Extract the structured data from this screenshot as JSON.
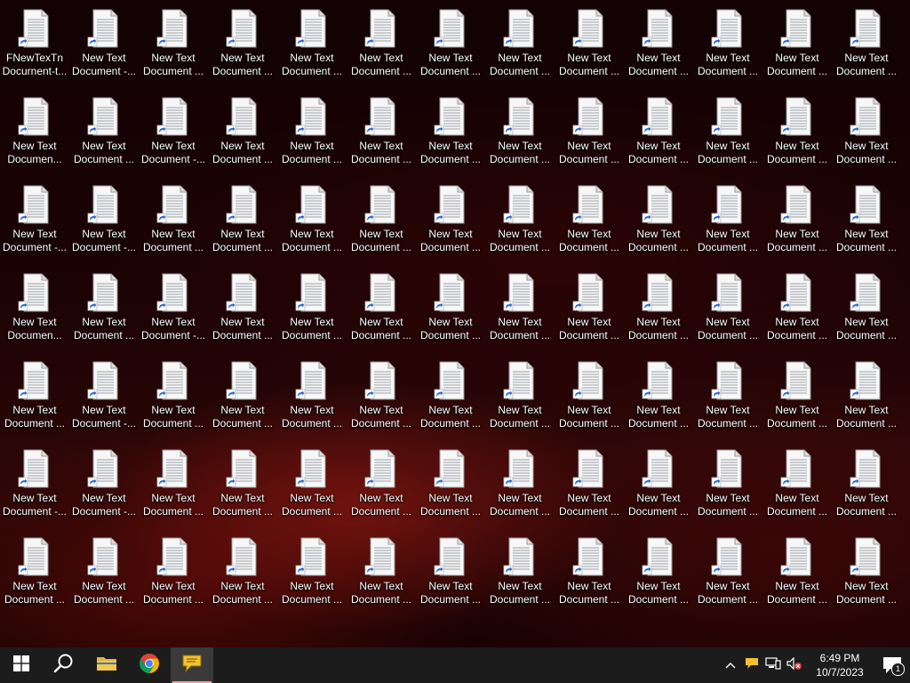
{
  "desktop": {
    "icon_rows": [
      [
        {
          "line1": "FNewTexTn",
          "line2": "Docurnent-t..."
        },
        {
          "line1": "New Text",
          "line2": "Document -..."
        },
        {
          "line1": "New Text",
          "line2": "Document ..."
        },
        {
          "line1": "New Text",
          "line2": "Document ..."
        },
        {
          "line1": "New Text",
          "line2": "Document ..."
        },
        {
          "line1": "New Text",
          "line2": "Document ..."
        },
        {
          "line1": "New Text",
          "line2": "Document ..."
        },
        {
          "line1": "New Text",
          "line2": "Document ..."
        },
        {
          "line1": "New Text",
          "line2": "Document ..."
        },
        {
          "line1": "New Text",
          "line2": "Document ..."
        },
        {
          "line1": "New Text",
          "line2": "Document ..."
        },
        {
          "line1": "New Text",
          "line2": "Document ..."
        },
        {
          "line1": "New Text",
          "line2": "Document ..."
        }
      ],
      [
        {
          "line1": "New Text",
          "line2": "Documen..."
        },
        {
          "line1": "New Text",
          "line2": "Document ..."
        },
        {
          "line1": "New Text",
          "line2": "Document -..."
        },
        {
          "line1": "New Text",
          "line2": "Document ..."
        },
        {
          "line1": "New Text",
          "line2": "Document ..."
        },
        {
          "line1": "New Text",
          "line2": "Document ..."
        },
        {
          "line1": "New Text",
          "line2": "Document ..."
        },
        {
          "line1": "New Text",
          "line2": "Document ..."
        },
        {
          "line1": "New Text",
          "line2": "Document ..."
        },
        {
          "line1": "New Text",
          "line2": "Document ..."
        },
        {
          "line1": "New Text",
          "line2": "Document ..."
        },
        {
          "line1": "New Text",
          "line2": "Document ..."
        },
        {
          "line1": "New Text",
          "line2": "Document ..."
        }
      ],
      [
        {
          "line1": "New Text",
          "line2": "Document -..."
        },
        {
          "line1": "New Text",
          "line2": "Document -..."
        },
        {
          "line1": "New Text",
          "line2": "Document ..."
        },
        {
          "line1": "New Text",
          "line2": "Document ..."
        },
        {
          "line1": "New Text",
          "line2": "Document ..."
        },
        {
          "line1": "New Text",
          "line2": "Document ..."
        },
        {
          "line1": "New Text",
          "line2": "Document ..."
        },
        {
          "line1": "New Text",
          "line2": "Document ..."
        },
        {
          "line1": "New Text",
          "line2": "Document ..."
        },
        {
          "line1": "New Text",
          "line2": "Document ..."
        },
        {
          "line1": "New Text",
          "line2": "Document ..."
        },
        {
          "line1": "New Text",
          "line2": "Document ..."
        },
        {
          "line1": "New Text",
          "line2": "Document ..."
        }
      ],
      [
        {
          "line1": "New Text",
          "line2": "Documen..."
        },
        {
          "line1": "New Text",
          "line2": "Document ..."
        },
        {
          "line1": "New Text",
          "line2": "Document -..."
        },
        {
          "line1": "New Text",
          "line2": "Document ..."
        },
        {
          "line1": "New Text",
          "line2": "Document ..."
        },
        {
          "line1": "New Text",
          "line2": "Document ..."
        },
        {
          "line1": "New Text",
          "line2": "Document ..."
        },
        {
          "line1": "New Text",
          "line2": "Document ..."
        },
        {
          "line1": "New Text",
          "line2": "Document ..."
        },
        {
          "line1": "New Text",
          "line2": "Document ..."
        },
        {
          "line1": "New Text",
          "line2": "Document ..."
        },
        {
          "line1": "New Text",
          "line2": "Document ..."
        },
        {
          "line1": "New Text",
          "line2": "Document ..."
        }
      ],
      [
        {
          "line1": "New Text",
          "line2": "Document ..."
        },
        {
          "line1": "New Text",
          "line2": "Document -..."
        },
        {
          "line1": "New Text",
          "line2": "Document ..."
        },
        {
          "line1": "New Text",
          "line2": "Document ..."
        },
        {
          "line1": "New Text",
          "line2": "Document ..."
        },
        {
          "line1": "New Text",
          "line2": "Document ..."
        },
        {
          "line1": "New Text",
          "line2": "Document ..."
        },
        {
          "line1": "New Text",
          "line2": "Document ..."
        },
        {
          "line1": "New Text",
          "line2": "Document ..."
        },
        {
          "line1": "New Text",
          "line2": "Document ..."
        },
        {
          "line1": "New Text",
          "line2": "Document ..."
        },
        {
          "line1": "New Text",
          "line2": "Document ..."
        },
        {
          "line1": "New Text",
          "line2": "Document ..."
        }
      ],
      [
        {
          "line1": "New Text",
          "line2": "Document -..."
        },
        {
          "line1": "New Text",
          "line2": "Document -..."
        },
        {
          "line1": "New Text",
          "line2": "Document ..."
        },
        {
          "line1": "New Text",
          "line2": "Document ..."
        },
        {
          "line1": "New Text",
          "line2": "Document ..."
        },
        {
          "line1": "New Text",
          "line2": "Document ..."
        },
        {
          "line1": "New Text",
          "line2": "Document ..."
        },
        {
          "line1": "New Text",
          "line2": "Document ..."
        },
        {
          "line1": "New Text",
          "line2": "Document ..."
        },
        {
          "line1": "New Text",
          "line2": "Document ..."
        },
        {
          "line1": "New Text",
          "line2": "Document ..."
        },
        {
          "line1": "New Text",
          "line2": "Document ..."
        },
        {
          "line1": "New Text",
          "line2": "Document ..."
        }
      ],
      [
        {
          "line1": "New Text",
          "line2": "Document ..."
        },
        {
          "line1": "New Text",
          "line2": "Document ..."
        },
        {
          "line1": "New Text",
          "line2": "Document ..."
        },
        {
          "line1": "New Text",
          "line2": "Document ..."
        },
        {
          "line1": "New Text",
          "line2": "Document ..."
        },
        {
          "line1": "New Text",
          "line2": "Document ..."
        },
        {
          "line1": "New Text",
          "line2": "Document ..."
        },
        {
          "line1": "New Text",
          "line2": "Document ..."
        },
        {
          "line1": "New Text",
          "line2": "Document ..."
        },
        {
          "line1": "New Text",
          "line2": "Document ..."
        },
        {
          "line1": "New Text",
          "line2": "Document ..."
        },
        {
          "line1": "New Text",
          "line2": "Document ..."
        },
        {
          "line1": "New Text",
          "line2": "Document ..."
        }
      ]
    ]
  },
  "taskbar": {
    "buttons": [
      {
        "name": "start-button",
        "icon": "windows-logo-icon"
      },
      {
        "name": "search-button",
        "icon": "search-icon"
      },
      {
        "name": "file-explorer-button",
        "icon": "folder-icon"
      },
      {
        "name": "chrome-button",
        "icon": "chrome-icon"
      },
      {
        "name": "speech-app-button",
        "icon": "speech-bubble-icon",
        "active": true
      }
    ],
    "tray": {
      "icons": [
        "chevron-up-icon",
        "speech-bubble-icon",
        "network-icon",
        "volume-muted-icon"
      ],
      "time": "6:49 PM",
      "date": "10/7/2023",
      "notification_count": "1"
    }
  },
  "colors": {
    "taskbar_bg": "#1c1c1c",
    "active_underline": "#e8a0a0",
    "shortcut_arrow": "#2f6fd1"
  }
}
